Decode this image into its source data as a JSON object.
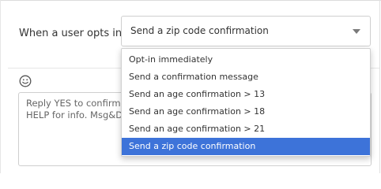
{
  "form": {
    "opt_in_label": "When a user opts in",
    "select": {
      "value": "Send a zip code confirmation",
      "options": [
        "Opt-in immediately",
        "Send a confirmation message",
        "Send an age confirmation > 13",
        "Send an age confirmation > 18",
        "Send an age confirmation > 21",
        "Send a zip code confirmation"
      ],
      "selected_index": 5
    }
  },
  "message": {
    "lines": [
      "Reply YES to confirm y",
      "HELP for info. Msg&Da"
    ]
  },
  "icons": {
    "emoji": "smiley-face-icon",
    "caret": "chevron-down-icon"
  },
  "colors": {
    "selected_option_bg": "#3d73d9",
    "selected_option_text": "#ffffff"
  }
}
